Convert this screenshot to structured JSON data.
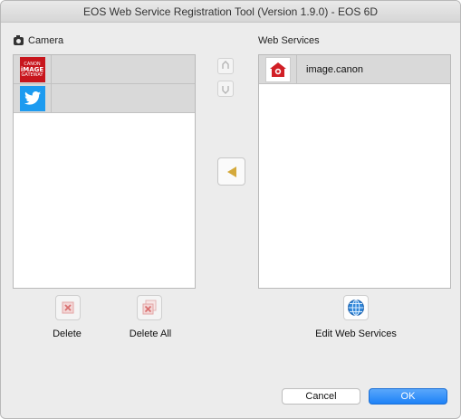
{
  "window": {
    "title": "EOS Web Service Registration Tool (Version 1.9.0) - EOS 6D"
  },
  "camera_panel": {
    "label": "Camera",
    "items": [
      {
        "icon": "canon-image-gateway-icon",
        "line1": "CANON",
        "line2": "iMAGE",
        "line3": "GATEWAY",
        "label": ""
      },
      {
        "icon": "twitter-icon",
        "label": ""
      }
    ]
  },
  "web_services_panel": {
    "label": "Web Services",
    "items": [
      {
        "icon": "image-canon-icon",
        "label": "image.canon"
      }
    ]
  },
  "actions": {
    "delete_label": "Delete",
    "delete_all_label": "Delete All",
    "edit_web_services_label": "Edit Web Services"
  },
  "dialog_buttons": {
    "cancel_label": "Cancel",
    "ok_label": "OK"
  },
  "colors": {
    "accent": "#1e82f7",
    "canon_red": "#c8161d",
    "twitter_blue": "#1d9bf0",
    "add_arrow": "#d4a93b"
  }
}
